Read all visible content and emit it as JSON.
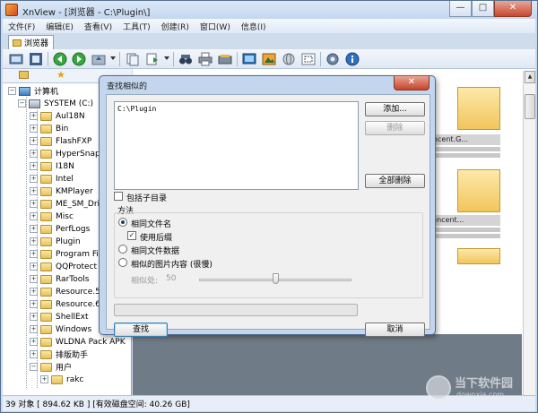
{
  "window": {
    "title": "XnView - [浏览器 - C:\\Plugin\\]"
  },
  "controls": {
    "minimize": "—",
    "maximize": "□",
    "close": "✕"
  },
  "menu": [
    "文件(F)",
    "编辑(E)",
    "查看(V)",
    "工具(T)",
    "创建(R)",
    "窗口(W)",
    "信息(I)"
  ],
  "tab": {
    "label": "浏览器"
  },
  "tree": {
    "root": "计算机",
    "drive": "SYSTEM (C:)",
    "folders": [
      "Aul18N",
      "Bin",
      "FlashFXP",
      "HyperSnap 6",
      "I18N",
      "Intel",
      "KMPlayer",
      "ME_SM_Driv",
      "Misc",
      "PerfLogs",
      "Plugin",
      "Program File",
      "QQProtect",
      "RarTools",
      "Resource.5.1",
      "Resource.6.2",
      "ShellExt",
      "Windows",
      "WLDNA Pack APK",
      "排版助手",
      "用户"
    ],
    "user_child": "rakc"
  },
  "thumbnails": [
    {
      "label": "encent.G..."
    },
    {
      "label": "Fencent..."
    }
  ],
  "status": {
    "text": "39 对象 [ 894.62 KB ] [有效磁盘空间: 40.26 GB]"
  },
  "watermark": {
    "line1": "当下软件园",
    "line2": "downxia.com"
  },
  "dialog": {
    "title": "查找相似的",
    "close_label": "✕",
    "paths": [
      "C:\\Plugin"
    ],
    "add_label": "添加...",
    "delete_label": "删除",
    "delete_all_label": "全部删除",
    "include_subdirs_label": "包括子目录",
    "include_subdirs_checked": false,
    "method_label": "方法",
    "options": [
      {
        "label": "相同文件名",
        "selected": true
      },
      {
        "label": "相同文件数据",
        "selected": false
      },
      {
        "label": "相似的图片内容 (很慢)",
        "selected": false
      }
    ],
    "use_suffix_label": "使用后缀",
    "use_suffix_checked": true,
    "similarity_label": "相似处:",
    "similarity_value": "50",
    "slider_fraction": 0.5,
    "find_label": "查找",
    "cancel_label": "取消"
  }
}
